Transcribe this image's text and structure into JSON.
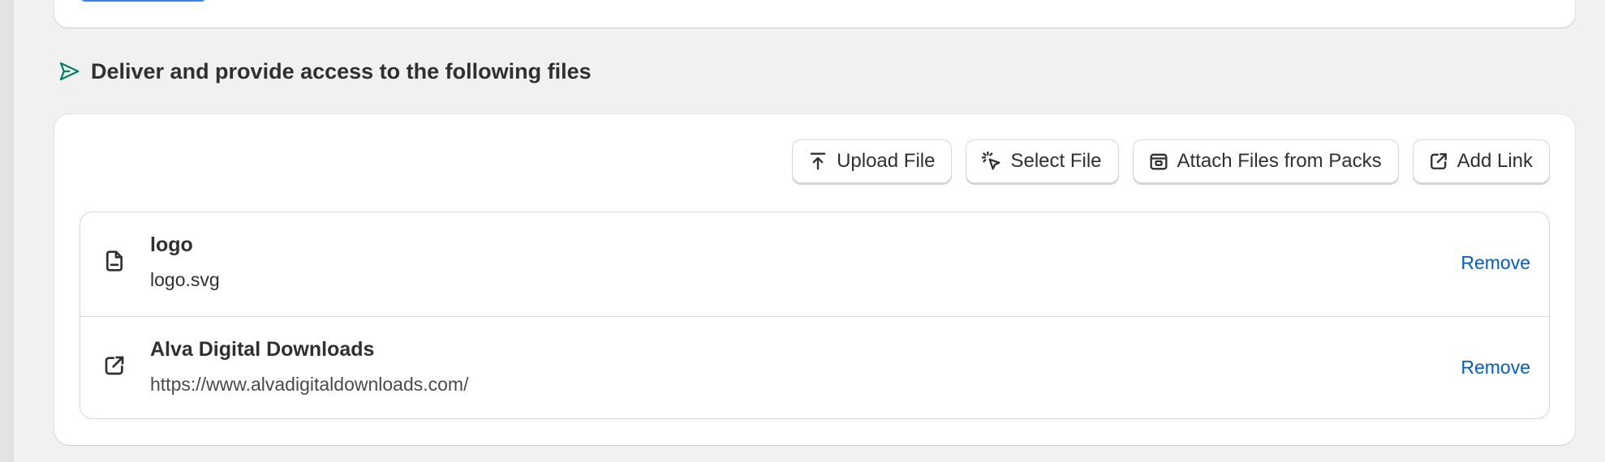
{
  "section": {
    "title": "Deliver and provide access to the following files",
    "icon": "send-icon",
    "icon_color": "#008060"
  },
  "toolbar": {
    "upload_label": "Upload File",
    "select_label": "Select File",
    "attach_label": "Attach Files from Packs",
    "add_link_label": "Add Link"
  },
  "files": [
    {
      "name": "logo",
      "detail": "logo.svg",
      "icon": "file-icon",
      "remove_label": "Remove"
    },
    {
      "name": "Alva Digital Downloads",
      "detail": "https://www.alvadigitaldownloads.com/",
      "icon": "external-link-icon",
      "remove_label": "Remove"
    }
  ],
  "colors": {
    "link": "#005bd3",
    "page_background": "#f1f1f1",
    "primary_button": "#3b82f6"
  }
}
